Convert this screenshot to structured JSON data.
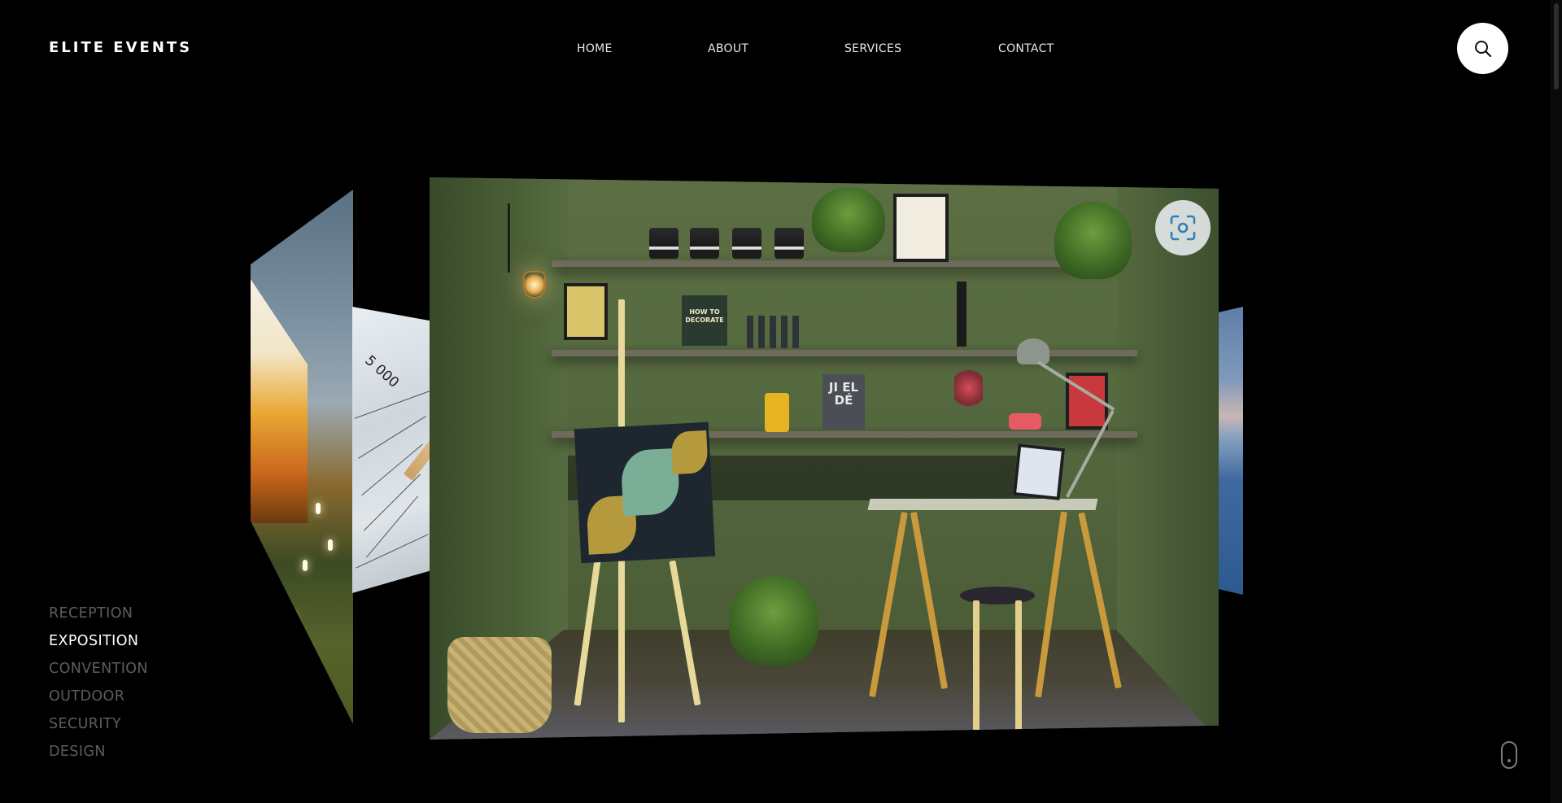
{
  "header": {
    "logo": "ELITE EVENTS",
    "nav": [
      {
        "label": "HOME"
      },
      {
        "label": "ABOUT"
      },
      {
        "label": "SERVICES"
      },
      {
        "label": "CONTACT"
      }
    ],
    "search_icon": "search-icon"
  },
  "carousel": {
    "slides": [
      {
        "name": "outdoor-reception-tent-photo"
      },
      {
        "name": "blueprint-pencil-photo"
      },
      {
        "name": "exposition-booth-photo"
      },
      {
        "name": "waterfront-photo"
      }
    ],
    "overlay_icon": "screen-capture-icon",
    "slide_texts": {
      "blueprint_number": "5 000",
      "book_decorate": "HOW TO DECORATE",
      "book_jielde": "JI EL DÉ"
    }
  },
  "categories": [
    {
      "label": "RECEPTION",
      "active": false
    },
    {
      "label": "EXPOSITION",
      "active": true
    },
    {
      "label": "CONVENTION",
      "active": false
    },
    {
      "label": "OUTDOOR",
      "active": false
    },
    {
      "label": "SECURITY",
      "active": false
    },
    {
      "label": "DESIGN",
      "active": false
    }
  ],
  "scroll_indicator_icon": "mouse-scroll-icon",
  "colors": {
    "background": "#000000",
    "text": "#ffffff",
    "inactive_category": "#5d5d5d",
    "accent_icon": "#2f7fb8"
  }
}
